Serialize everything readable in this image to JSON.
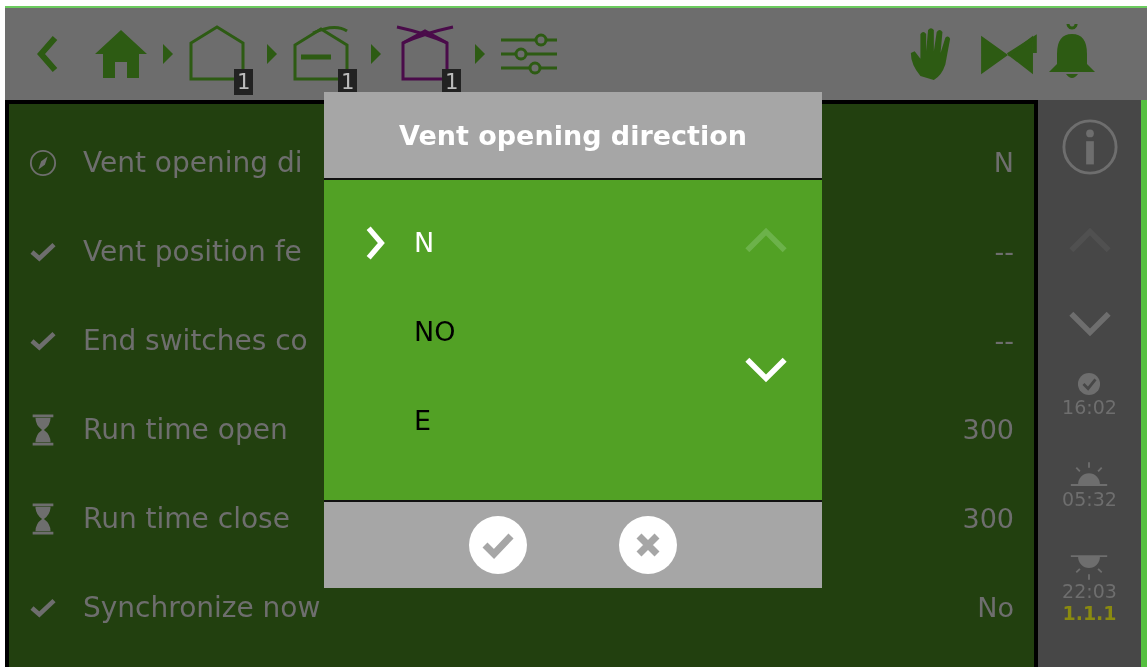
{
  "top_bar": {
    "breadcrumbs": [
      {
        "kind": "house",
        "badge": "1",
        "selected": false
      },
      {
        "kind": "vent",
        "badge": "1",
        "selected": false
      },
      {
        "kind": "roof",
        "badge": "1",
        "selected": true
      }
    ]
  },
  "settings": [
    {
      "kind": "direction",
      "label": "Vent opening di",
      "value": "N"
    },
    {
      "kind": "check",
      "label": "Vent position fe",
      "value": "--"
    },
    {
      "kind": "check",
      "label": "End switches co",
      "value": "--"
    },
    {
      "kind": "time",
      "label": "Run time open",
      "value": "300"
    },
    {
      "kind": "time",
      "label": "Run time close",
      "value": "300"
    },
    {
      "kind": "check",
      "label": "Synchronize now",
      "value": "No"
    }
  ],
  "sidebar": {
    "scroll_up": {
      "disabled": true
    },
    "scroll_down": {
      "disabled": false
    },
    "times": [
      {
        "kind": "clock",
        "text": "16:02"
      },
      {
        "kind": "sunrise",
        "text": "05:32"
      },
      {
        "kind": "sunset",
        "text": "22:03"
      }
    ],
    "version": "1.1.1"
  },
  "dialog": {
    "title": "Vent opening direction",
    "options": [
      {
        "label": "N",
        "selected": true
      },
      {
        "label": "NO",
        "selected": false
      },
      {
        "label": "E",
        "selected": false
      }
    ],
    "scroll_up": {
      "disabled": true
    },
    "scroll_down": {
      "disabled": false
    }
  }
}
